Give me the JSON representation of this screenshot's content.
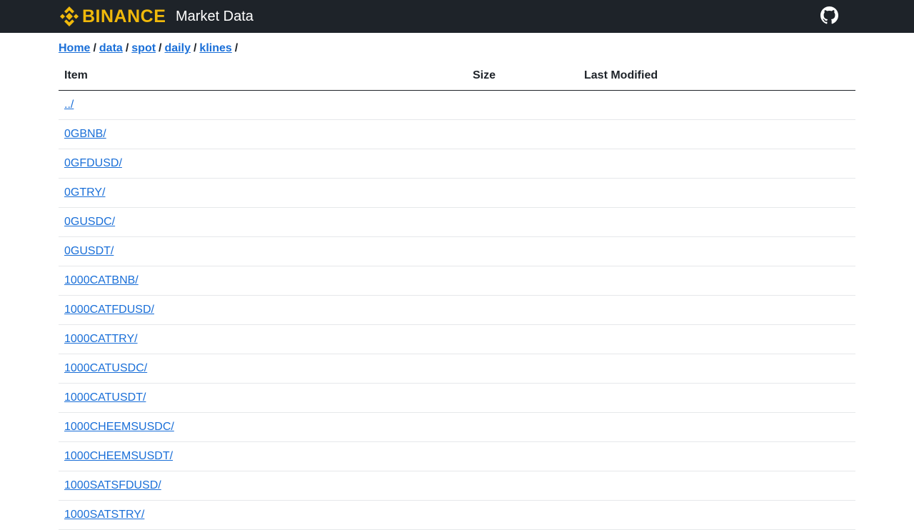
{
  "header": {
    "brand": "BINANCE",
    "title": "Market Data",
    "github_icon": "github-icon",
    "brand_color": "#f0b90b",
    "bar_color": "#1e2329"
  },
  "breadcrumb": {
    "items": [
      "Home",
      "data",
      "spot",
      "daily",
      "klines"
    ],
    "separator": "/"
  },
  "table": {
    "columns": [
      "Item",
      "Size",
      "Last Modified"
    ],
    "rows": [
      {
        "item": "../",
        "size": "",
        "modified": ""
      },
      {
        "item": "0GBNB/",
        "size": "",
        "modified": ""
      },
      {
        "item": "0GFDUSD/",
        "size": "",
        "modified": ""
      },
      {
        "item": "0GTRY/",
        "size": "",
        "modified": ""
      },
      {
        "item": "0GUSDC/",
        "size": "",
        "modified": ""
      },
      {
        "item": "0GUSDT/",
        "size": "",
        "modified": ""
      },
      {
        "item": "1000CATBNB/",
        "size": "",
        "modified": ""
      },
      {
        "item": "1000CATFDUSD/",
        "size": "",
        "modified": ""
      },
      {
        "item": "1000CATTRY/",
        "size": "",
        "modified": ""
      },
      {
        "item": "1000CATUSDC/",
        "size": "",
        "modified": ""
      },
      {
        "item": "1000CATUSDT/",
        "size": "",
        "modified": ""
      },
      {
        "item": "1000CHEEMSUSDC/",
        "size": "",
        "modified": ""
      },
      {
        "item": "1000CHEEMSUSDT/",
        "size": "",
        "modified": ""
      },
      {
        "item": "1000SATSFDUSD/",
        "size": "",
        "modified": ""
      },
      {
        "item": "1000SATSTRY/",
        "size": "",
        "modified": ""
      }
    ]
  },
  "link_color": "#1a6fd8"
}
